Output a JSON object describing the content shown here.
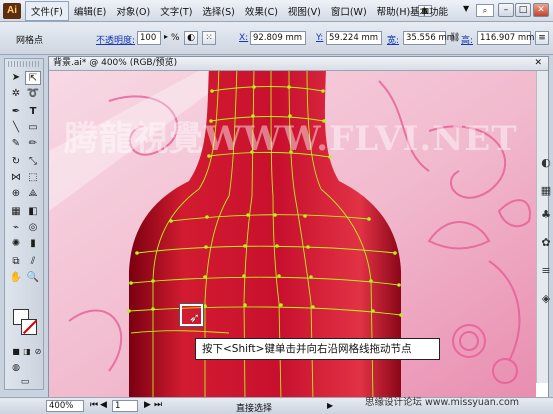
{
  "app": {
    "logo": "Ai"
  },
  "menu": {
    "items": [
      "文件(F)",
      "编辑(E)",
      "对象(O)",
      "文字(T)",
      "选择(S)",
      "效果(C)",
      "视图(V)",
      "窗口(W)",
      "帮助(H)"
    ],
    "workspace": "基本功能"
  },
  "control_bar": {
    "object_type": "网格点",
    "opacity_label": "不透明度:",
    "opacity_value": "100",
    "opacity_unit": "%",
    "x_label": "X:",
    "x_value": "92.809 mm",
    "y_label": "Y:",
    "y_value": "59.224 mm",
    "w_label": "宽:",
    "w_value": "35.556 mm",
    "h_label": "高:",
    "h_value": "116.907 mm"
  },
  "document": {
    "tab_title": "背景.ai* @ 400% (RGB/预览)",
    "watermark_text": "腾龍視覺WWW.FLVI.NET"
  },
  "status_bar": {
    "zoom": "400%",
    "page": "1",
    "current_tool": "直接选择",
    "site_watermark": "思缘设计论坛  www.missyuan.com"
  },
  "callout": {
    "text": "按下<Shift>键单击并向右沿网格线拖动节点"
  },
  "colors": {
    "bottle": "#c8102e",
    "mesh_line": "#b7f21a",
    "background": "#f4c9d8"
  }
}
